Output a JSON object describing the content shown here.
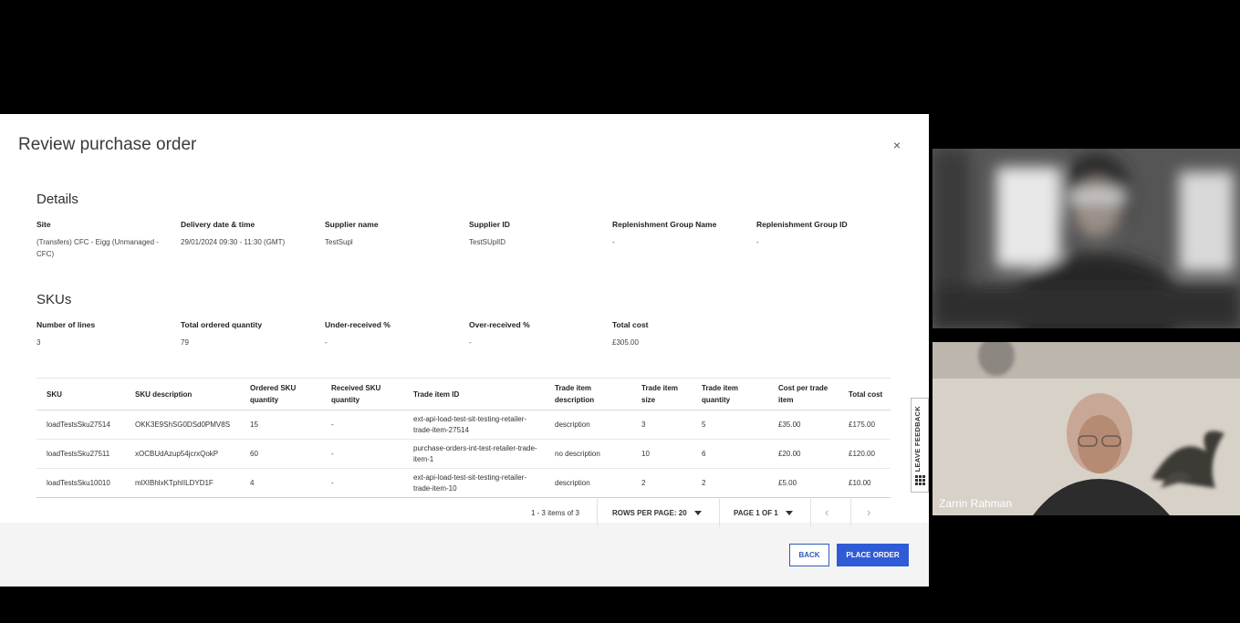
{
  "modal": {
    "title": "Review purchase order",
    "close_label": "×"
  },
  "details": {
    "heading": "Details",
    "fields": [
      {
        "label": "Site",
        "value": "(Transfers) CFC - Eigg (Unmanaged - CFC)"
      },
      {
        "label": "Delivery date & time",
        "value": "29/01/2024 09:30 - 11:30 (GMT)"
      },
      {
        "label": "Supplier name",
        "value": "TestSupl"
      },
      {
        "label": "Supplier ID",
        "value": "TestSUplID"
      },
      {
        "label": "Replenishment Group Name",
        "value": "-"
      },
      {
        "label": "Replenishment Group ID",
        "value": "-"
      }
    ]
  },
  "skus": {
    "heading": "SKUs",
    "fields": [
      {
        "label": "Number of lines",
        "value": "3"
      },
      {
        "label": "Total ordered quantity",
        "value": "79"
      },
      {
        "label": "Under-received %",
        "value": "-"
      },
      {
        "label": "Over-received %",
        "value": "-"
      },
      {
        "label": "Total cost",
        "value": "£305.00"
      }
    ]
  },
  "table": {
    "columns": [
      "SKU",
      "SKU description",
      "Ordered SKU quantity",
      "Received SKU quantity",
      "Trade item ID",
      "Trade item description",
      "Trade item size",
      "Trade item quantity",
      "Cost per trade item",
      "Total cost"
    ],
    "rows": [
      [
        "loadTestsSku27514",
        "OKK3E9ShSG0DSd0PMV8S",
        "15",
        "-",
        "ext-api-load-test-sit-testing-retailer-trade-item-27514",
        "description",
        "3",
        "5",
        "£35.00",
        "£175.00"
      ],
      [
        "loadTestsSku27511",
        "xOCBUdAzup54jcrxQokP",
        "60",
        "-",
        "purchase-orders-int-test-retailer-trade-item-1",
        "no description",
        "10",
        "6",
        "£20.00",
        "£120.00"
      ],
      [
        "loadTestsSku10010",
        "mlXIBhlxKTphIILDYD1F",
        "4",
        "-",
        "ext-api-load-test-sit-testing-retailer-trade-item-10",
        "description",
        "2",
        "2",
        "£5.00",
        "£10.00"
      ]
    ]
  },
  "pagination": {
    "count": "1 - 3 items of 3",
    "rows_per_page": "ROWS PER PAGE: 20",
    "page": "PAGE 1 OF 1",
    "prev_glyph": "‹",
    "next_glyph": "›"
  },
  "footer": {
    "back_label": "BACK",
    "place_order_label": "PLACE ORDER"
  },
  "feedback": {
    "label": "LEAVE FEEDBACK"
  },
  "video": {
    "participant_name": "Zarrin Rahman"
  },
  "colors": {
    "primary": "#2f5bd6",
    "primary_outline": "#2f5bb7"
  },
  "icons": {
    "close": "close-icon",
    "rows_dropdown": "chevron-down-icon",
    "page_dropdown": "chevron-down-icon",
    "prev": "chevron-left-icon",
    "next": "chevron-right-icon",
    "feedback": "grid-icon"
  }
}
